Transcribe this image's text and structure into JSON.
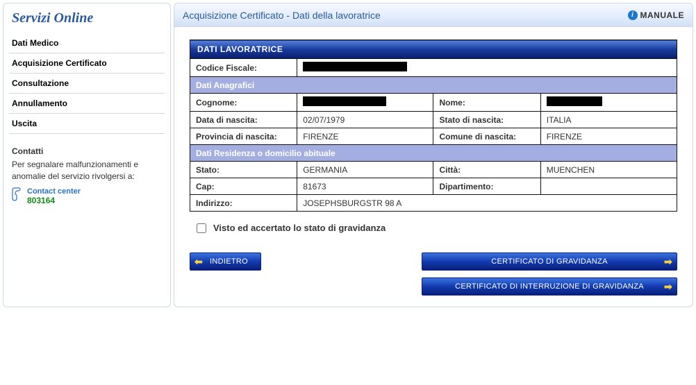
{
  "sidebar": {
    "title": "Servizi Online",
    "items": [
      {
        "label": "Dati Medico"
      },
      {
        "label": "Acquisizione Certificato"
      },
      {
        "label": "Consultazione"
      },
      {
        "label": "Annullamento"
      },
      {
        "label": "Uscita"
      }
    ],
    "contacts_title": "Contatti",
    "contacts_desc": "Per segnalare malfunzionamenti e anomalie del servizio rivolgersi a:",
    "cc_label": "Contact center",
    "cc_number": "803164"
  },
  "header": {
    "title": "Acquisizione Certificato - Dati della lavoratrice",
    "manual": "MANUALE"
  },
  "section": {
    "main": "DATI LAVORATRICE",
    "sub_anag": "Dati Anagrafici",
    "sub_res": "Dati Residenza o domicilio abituale"
  },
  "labels": {
    "cf": "Codice Fiscale:",
    "cognome": "Cognome:",
    "nome": "Nome:",
    "data_nascita": "Data di nascita:",
    "stato_nascita": "Stato di nascita:",
    "prov_nascita": "Provincia di nascita:",
    "comune_nascita": "Comune di nascita:",
    "stato": "Stato:",
    "citta": "Città:",
    "cap": "Cap:",
    "dipartimento": "Dipartimento:",
    "indirizzo": "Indirizzo:"
  },
  "values": {
    "data_nascita": "02/07/1979",
    "stato_nascita": "ITALIA",
    "prov_nascita": "FIRENZE",
    "comune_nascita": "FIRENZE",
    "stato": "GERMANIA",
    "citta": "MUENCHEN",
    "cap": "81673",
    "dipartimento": "",
    "indirizzo": "JOSEPHSBURGSTR 98 A"
  },
  "checkbox_label": "Visto ed accertato lo stato di gravidanza",
  "buttons": {
    "back": "INDIETRO",
    "cert_grav": "CERTIFICATO DI GRAVIDANZA",
    "cert_inter": "CERTIFICATO DI INTERRUZIONE DI GRAVIDANZA"
  }
}
